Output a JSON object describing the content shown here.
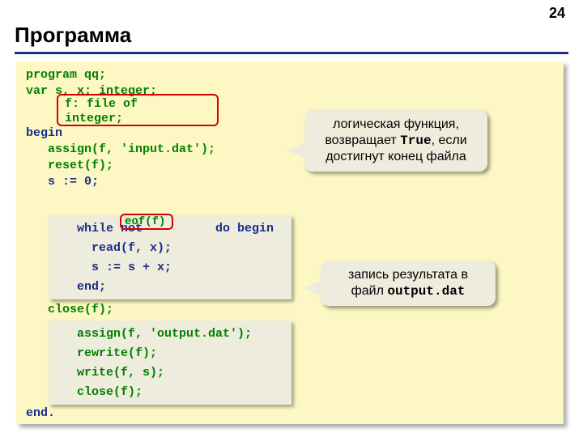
{
  "page_number": "24",
  "title": "Программа",
  "code": {
    "l1": "program qq;",
    "l2": "var s, x: integer;",
    "l3a": "f: file of",
    "l3b": "integer;",
    "l4": "begin",
    "l5": "   assign(f, 'input.dat');",
    "l6": "   reset(f);",
    "l7": "   s := 0;",
    "l8a": "   while not          do begin",
    "eof": "eof(f)",
    "l9": "     read(f, x);",
    "l10": "     s := s + x;",
    "l11": "   end;",
    "l12": "   close(f);",
    "l13": "   assign(f, 'output.dat');",
    "l14": "   rewrite(f);",
    "l15": "   write(f, s);",
    "l16": "   close(f);",
    "l17": "end."
  },
  "callout1": {
    "line1": "логическая функция,",
    "line2a": "возвращает ",
    "line2b": "True",
    "line2c": ", если",
    "line3": "достигнут конец файла"
  },
  "callout2": {
    "line1": "запись результата в",
    "line2a": "файл ",
    "line2b": "output.dat"
  },
  "chart_data": null
}
